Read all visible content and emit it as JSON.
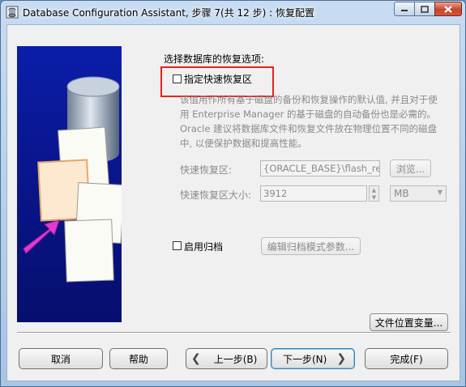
{
  "window": {
    "title": "Database Configuration Assistant, 步骤 7(共 12 步) : 恢复配置"
  },
  "recovery": {
    "section_label": "选择数据库的恢复选项:",
    "fast_recovery_checkbox_label": "指定快速恢复区",
    "fast_recovery_checked": false,
    "description_lines": [
      "该值用作所有基于磁盘的备份和恢复操作的默认值, 并且对于使",
      "用 Enterprise Manager 的基于磁盘的自动备份也是必需的。",
      "Oracle 建议将数据库文件和恢复文件放在物理位置不同的磁盘",
      "中, 以便保护数据和提高性能。"
    ],
    "fast_recovery_area_label": "快速恢复区:",
    "fast_recovery_area_value": "{ORACLE_BASE}\\flash_re",
    "browse_button": "浏览...",
    "fast_recovery_size_label": "快速恢复区大小:",
    "fast_recovery_size_value": "3912",
    "size_unit": "MB",
    "archive_checkbox_label": "启用归档",
    "archive_checked": false,
    "edit_archive_button": "编辑归档模式参数...",
    "file_location_button": "文件位置变量..."
  },
  "footer": {
    "cancel": "取消",
    "help": "帮助",
    "back": "上一步(B)",
    "next": "下一步(N)",
    "finish": "完成(F)"
  }
}
